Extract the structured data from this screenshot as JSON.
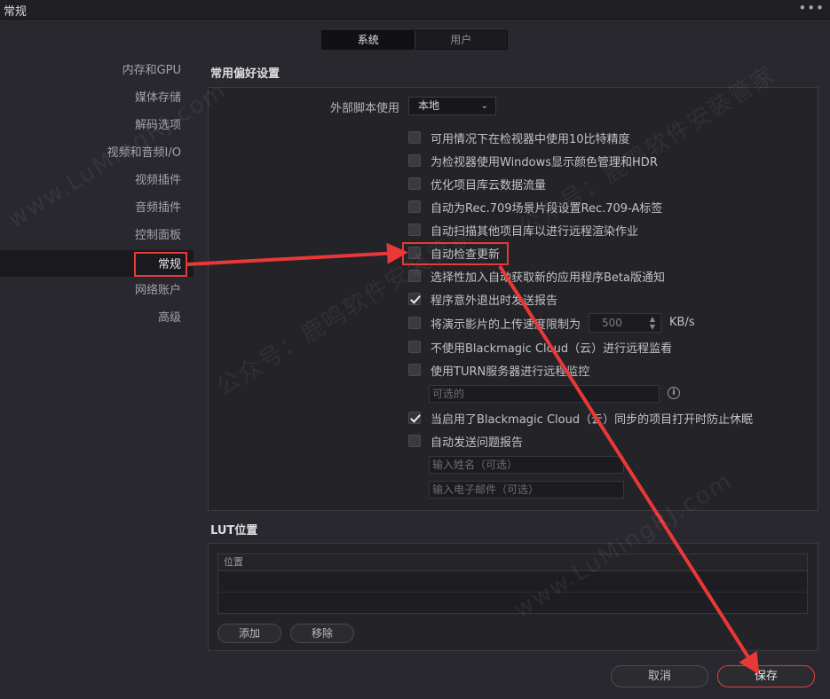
{
  "window": {
    "title": "常规",
    "more_icon": "more-dots-icon"
  },
  "tabs": [
    {
      "label": "系统",
      "active": true
    },
    {
      "label": "用户",
      "active": false
    }
  ],
  "sidebar": {
    "items": [
      {
        "label": "内存和GPU"
      },
      {
        "label": "媒体存储"
      },
      {
        "label": "解码选项"
      },
      {
        "label": "视频和音频I/O"
      },
      {
        "label": "视频插件"
      },
      {
        "label": "音频插件"
      },
      {
        "label": "控制面板"
      },
      {
        "label": "常规",
        "selected": true
      },
      {
        "label": "网络账户"
      },
      {
        "label": "高级"
      }
    ]
  },
  "general": {
    "section_title": "常用偏好设置",
    "external_script_label": "外部脚本使用",
    "external_script_value": "本地",
    "options": [
      {
        "label": "可用情况下在检视器中使用10比特精度",
        "checked": false
      },
      {
        "label": "为检视器使用Windows显示颜色管理和HDR",
        "checked": false
      },
      {
        "label": "优化项目库云数据流量",
        "checked": false
      },
      {
        "label": "自动为Rec.709场景片段设置Rec.709-A标签",
        "checked": false
      },
      {
        "label": "自动扫描其他项目库以进行远程渲染作业",
        "checked": false
      },
      {
        "label": "自动检查更新",
        "checked": false
      },
      {
        "label": "选择性加入自动获取新的应用程序Beta版通知",
        "checked": false
      },
      {
        "label": "程序意外退出时发送报告",
        "checked": true
      },
      {
        "label": "将演示影片的上传速度限制为",
        "checked": false
      },
      {
        "label": "不使用Blackmagic Cloud（云）进行远程监看",
        "checked": false
      },
      {
        "label": "使用TURN服务器进行远程监控",
        "checked": false
      },
      {
        "label": "当启用了Blackmagic Cloud（云）同步的项目打开时防止休眠",
        "checked": true
      },
      {
        "label": "自动发送问题报告",
        "checked": false
      }
    ],
    "upload_limit_value": "500",
    "upload_limit_unit": "KB/s",
    "turn_placeholder": "可选的",
    "name_placeholder": "输入姓名（可选）",
    "email_placeholder": "输入电子邮件（可选）"
  },
  "lut": {
    "section_title": "LUT位置",
    "column_header": "位置",
    "add_label": "添加",
    "remove_label": "移除"
  },
  "footer": {
    "cancel_label": "取消",
    "save_label": "保存"
  },
  "annotation_color": "#e83838",
  "watermark_texts": [
    "公众号：鹿鸣软件安装管家",
    "www.LuMingRJ.com"
  ]
}
